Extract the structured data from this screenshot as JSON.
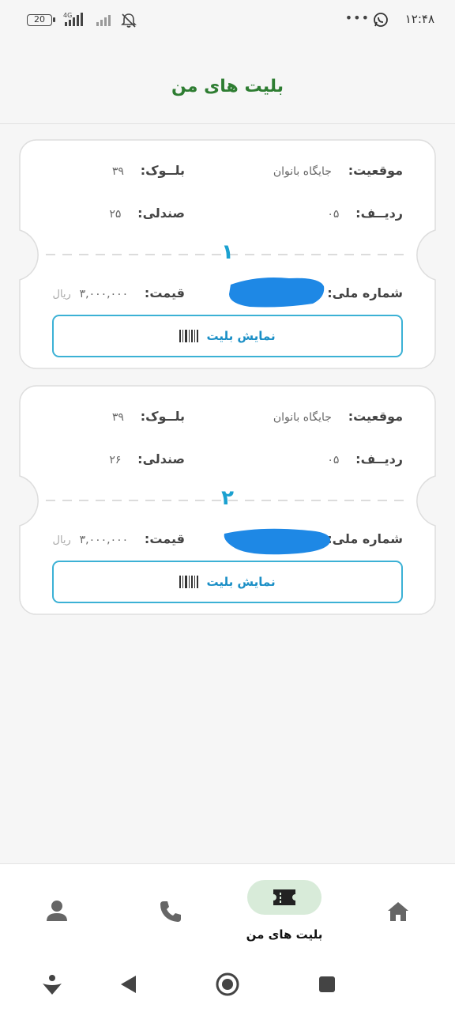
{
  "status_bar": {
    "time": "۱۲:۴۸",
    "battery": "20",
    "network": "4G",
    "dots": "•••"
  },
  "header": {
    "title": "بلیت های من"
  },
  "tickets": [
    {
      "number": "۱",
      "location_label": "موقعیت:",
      "location_value": "جایگاه بانوان",
      "block_label": "بلــوک:",
      "block_value": "۳۹",
      "row_label": "ردیــف:",
      "row_value": "۰۵",
      "seat_label": "صندلی:",
      "seat_value": "۲۵",
      "national_id_label": "شماره ملی:",
      "price_label": "قیمت:",
      "price_value": "۳,۰۰۰,۰۰۰",
      "currency": "ریال",
      "show_button_label": "نمایش بلیت"
    },
    {
      "number": "۲",
      "location_label": "موقعیت:",
      "location_value": "جایگاه بانوان",
      "block_label": "بلــوک:",
      "block_value": "۳۹",
      "row_label": "ردیــف:",
      "row_value": "۰۵",
      "seat_label": "صندلی:",
      "seat_value": "۲۶",
      "national_id_label": "شماره ملی:",
      "price_label": "قیمت:",
      "price_value": "۳,۰۰۰,۰۰۰",
      "currency": "ریال",
      "show_button_label": "نمایش بلیت"
    }
  ],
  "bottom_nav": {
    "items": [
      {
        "icon": "home-icon"
      },
      {
        "icon": "ticket-icon",
        "label": "بلیت های من",
        "active": true
      },
      {
        "icon": "phone-icon"
      },
      {
        "icon": "profile-icon"
      }
    ],
    "active_color": "#d8ebd9"
  },
  "colors": {
    "accent": "#1ba1d0",
    "title": "#2e7d32",
    "redaction": "#1e88e5"
  }
}
